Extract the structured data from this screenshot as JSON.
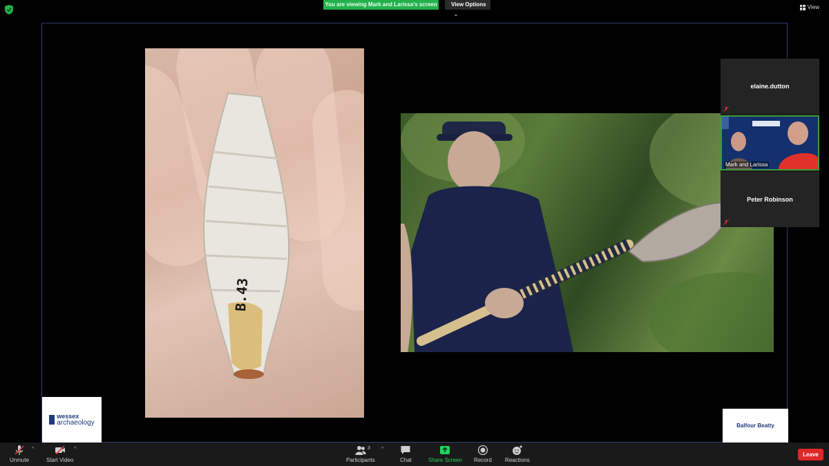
{
  "banner": {
    "viewing_text": "You are viewing Mark and Larissa's screen",
    "view_options_label": "View Options"
  },
  "top_right": {
    "view_label": "View"
  },
  "shared_screen": {
    "artifact_label": "B.43",
    "logos": {
      "wessex_line1": "wessex",
      "wessex_line2": "archaeology",
      "balfour": "Balfour Beatty"
    }
  },
  "participants": [
    {
      "name": "elaine.dutton",
      "muted": true
    },
    {
      "name": "Mark and Larissa",
      "muted": false,
      "video": true
    },
    {
      "name": "Peter Robinson",
      "muted": true
    }
  ],
  "toolbar": {
    "unmute_label": "Unmute",
    "start_video_label": "Start Video",
    "participants_label": "Participants",
    "participant_count": "3",
    "chat_label": "Chat",
    "share_screen_label": "Share Screen",
    "record_label": "Record",
    "reactions_label": "Reactions",
    "leave_label": "Leave"
  },
  "colors": {
    "share_green": "#23b14d",
    "leave_red": "#e02828",
    "active_border": "#3c9a3a"
  }
}
